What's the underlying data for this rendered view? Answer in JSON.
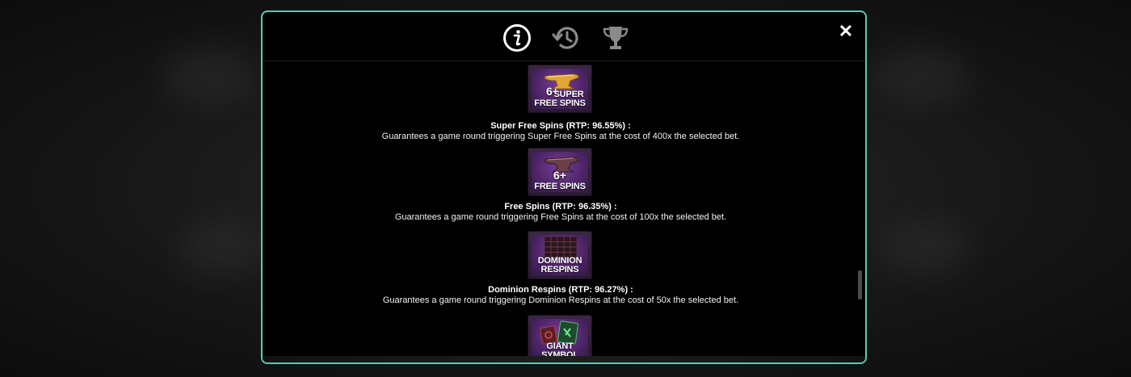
{
  "modal": {
    "tabs": [
      {
        "icon": "info-icon",
        "active": true
      },
      {
        "icon": "history-icon",
        "active": false
      },
      {
        "icon": "trophy-icon",
        "active": false
      }
    ],
    "close_label": "✕"
  },
  "features": [
    {
      "badge": {
        "plus": "6+",
        "label_line1": "SUPER",
        "label_line2": "FREE SPINS"
      },
      "title": "Super Free Spins (RTP: 96.55%) :",
      "description": "Guarantees a game round triggering Super Free Spins at the cost of 400x the selected bet."
    },
    {
      "badge": {
        "plus": "6+",
        "label_line1": "",
        "label_line2": "FREE SPINS"
      },
      "title": "Free Spins (RTP: 96.35%) :",
      "description": "Guarantees a game round triggering Free Spins at the cost of 100x the selected bet."
    },
    {
      "badge": {
        "plus": "",
        "label_line1": "DOMINION",
        "label_line2": "RESPINS"
      },
      "title": "Dominion Respins (RTP: 96.27%) :",
      "description": "Guarantees a game round triggering Dominion Respins at the cost of 50x the selected bet."
    },
    {
      "badge": {
        "plus": "",
        "label_line1": "GIANT",
        "label_line2": "SYMBOL"
      }
    }
  ],
  "colors": {
    "border_accent": "#5fc7b4",
    "badge_purple": "#4e2568",
    "text": "#ffffff"
  }
}
